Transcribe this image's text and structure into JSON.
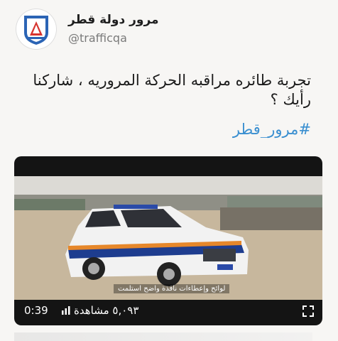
{
  "account": {
    "display_name": "مرور دولة قطر",
    "handle": "@trafficqa",
    "avatar_icon": "traffic-department-logo"
  },
  "tweet": {
    "text": "تجربة طائره مراقبه الحركة المروريه ، شاركنا رأيك ؟",
    "hashtag": "#مرور_قطر"
  },
  "video": {
    "caption": "لوائح وإعطاءات نافذة واضح استلمت",
    "duration": "0:39",
    "views": "٥,٠٩٣ مشاهدة",
    "colors": {
      "sky": "#d9d7d2",
      "sand": "#c8b79d",
      "vehicle_white": "#f1f1f1",
      "stripe_blue": "#1e3d8f",
      "stripe_orange": "#e6872a"
    }
  }
}
